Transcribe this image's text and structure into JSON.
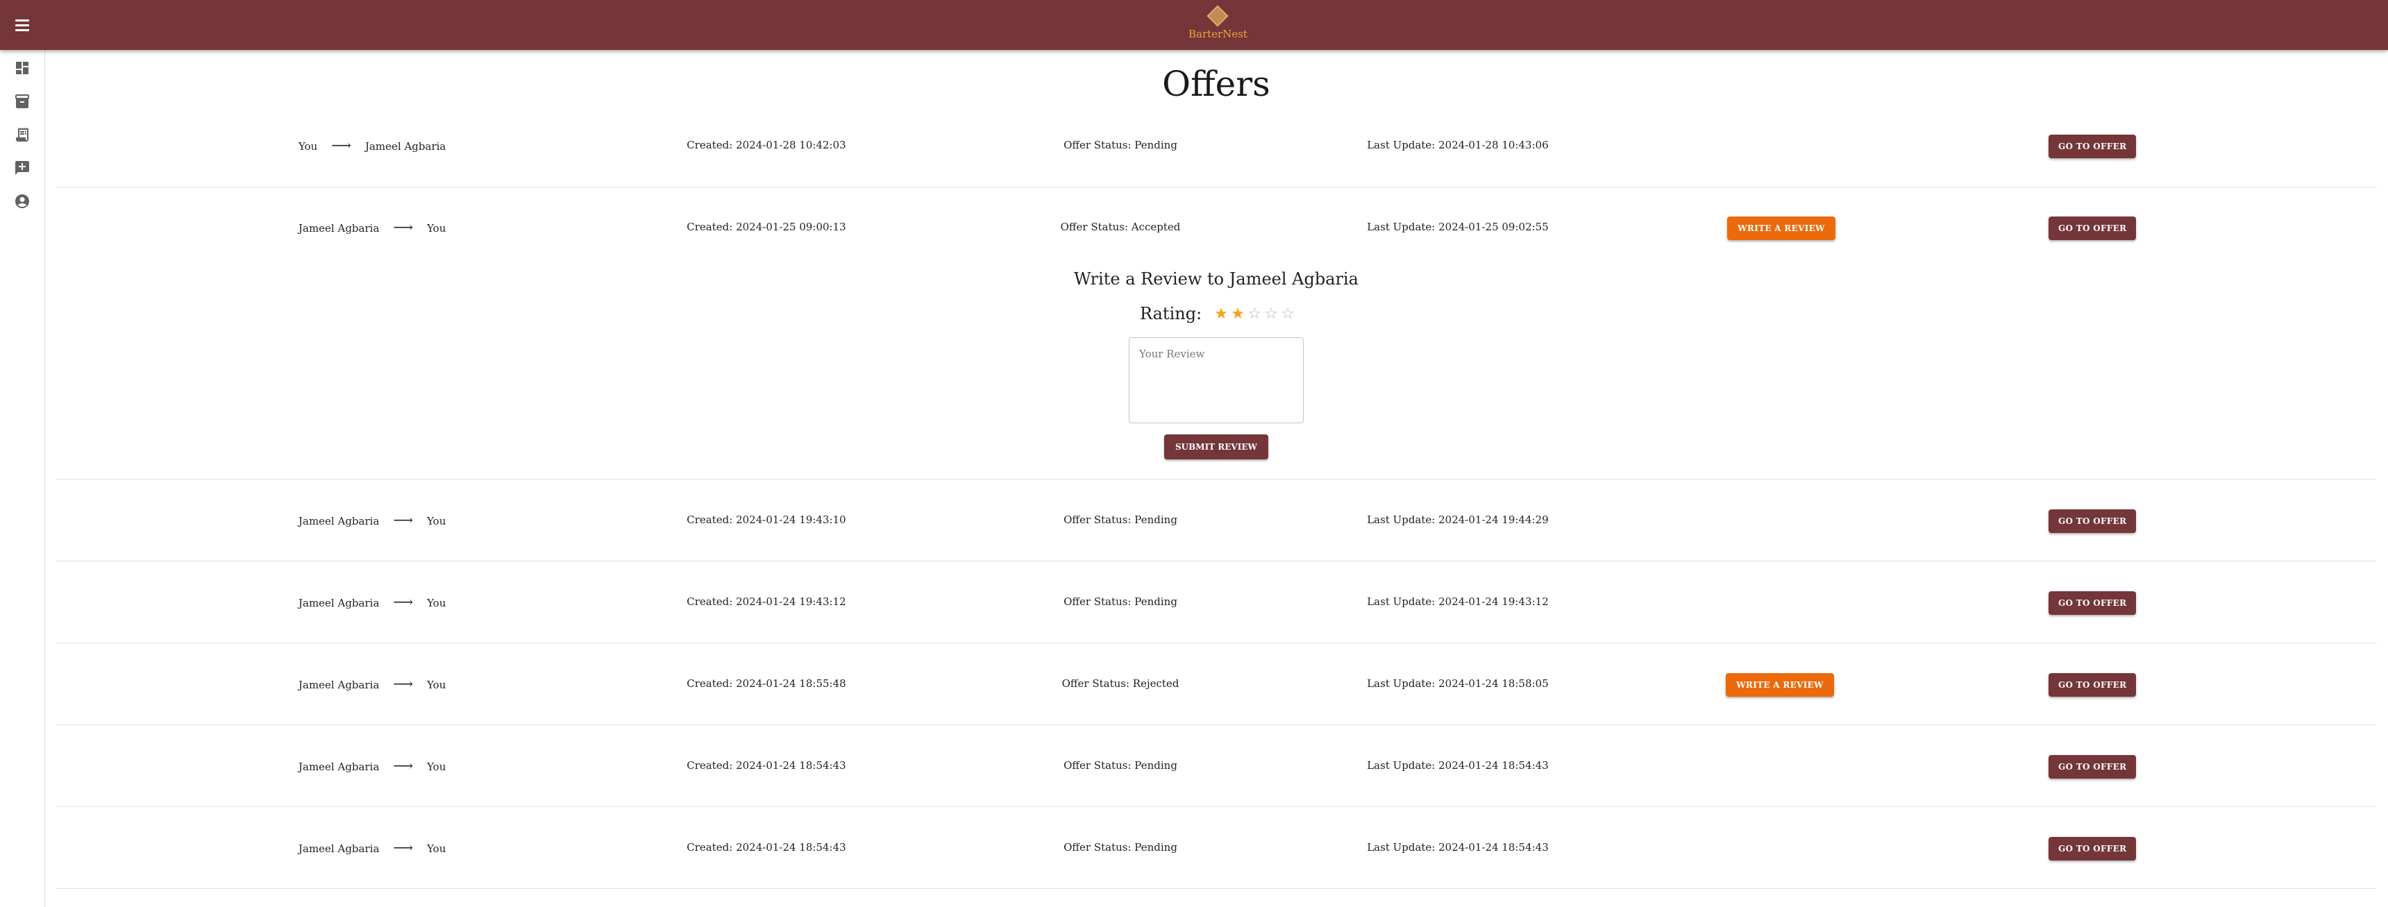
{
  "app": {
    "name": "BarterNest"
  },
  "topbar": {
    "menu_icon": "menu-icon",
    "logo_icon": "diamond-logo-icon",
    "logo_text": "BarterNest"
  },
  "sidebar": {
    "items": [
      {
        "icon": "dashboard-icon"
      },
      {
        "icon": "archive-icon"
      },
      {
        "icon": "receipt-icon"
      },
      {
        "icon": "add-comment-icon"
      },
      {
        "icon": "account-circle-icon"
      }
    ]
  },
  "page": {
    "title": "Offers"
  },
  "colors": {
    "brand": "#743639",
    "accent": "#ec6a0c",
    "star": "#f4a514"
  },
  "offers": [
    {
      "from": "You",
      "to": "Jameel Agbaria",
      "created": "Created: 2024-01-28 10:42:03",
      "status": "Offer Status: Pending",
      "updated": "Last Update: 2024-01-28 10:43:06",
      "go_label": "GO TO OFFER"
    },
    {
      "from": "Jameel Agbaria",
      "to": "You",
      "created": "Created: 2024-01-25 09:00:13",
      "status": "Offer Status: Accepted",
      "updated": "Last Update: 2024-01-25 09:02:55",
      "review_label": "WRITE A REVIEW",
      "go_label": "GO TO OFFER"
    },
    {
      "from": "Jameel Agbaria",
      "to": "You",
      "created": "Created: 2024-01-24 19:43:10",
      "status": "Offer Status: Pending",
      "updated": "Last Update: 2024-01-24 19:44:29",
      "go_label": "GO TO OFFER"
    },
    {
      "from": "Jameel Agbaria",
      "to": "You",
      "created": "Created: 2024-01-24 19:43:12",
      "status": "Offer Status: Pending",
      "updated": "Last Update: 2024-01-24 19:43:12",
      "go_label": "GO TO OFFER"
    },
    {
      "from": "Jameel Agbaria",
      "to": "You",
      "created": "Created: 2024-01-24 18:55:48",
      "status": "Offer Status: Rejected",
      "updated": "Last Update: 2024-01-24 18:58:05",
      "review_label": "WRITE A REVIEW",
      "go_label": "GO TO OFFER"
    },
    {
      "from": "Jameel Agbaria",
      "to": "You",
      "created": "Created: 2024-01-24 18:54:43",
      "status": "Offer Status: Pending",
      "updated": "Last Update: 2024-01-24 18:54:43",
      "go_label": "GO TO OFFER"
    },
    {
      "from": "Jameel Agbaria",
      "to": "You",
      "created": "Created: 2024-01-24 18:54:43",
      "status": "Offer Status: Pending",
      "updated": "Last Update: 2024-01-24 18:54:43",
      "go_label": "GO TO OFFER"
    }
  ],
  "review_form": {
    "title": "Write a Review to Jameel Agbaria",
    "rating_label": "Rating:",
    "rating": 2,
    "rating_max": 5,
    "star_filled": "★",
    "star_empty": "☆",
    "review_value": "",
    "review_placeholder": "Your Review",
    "submit_label": "SUBMIT REVIEW"
  }
}
